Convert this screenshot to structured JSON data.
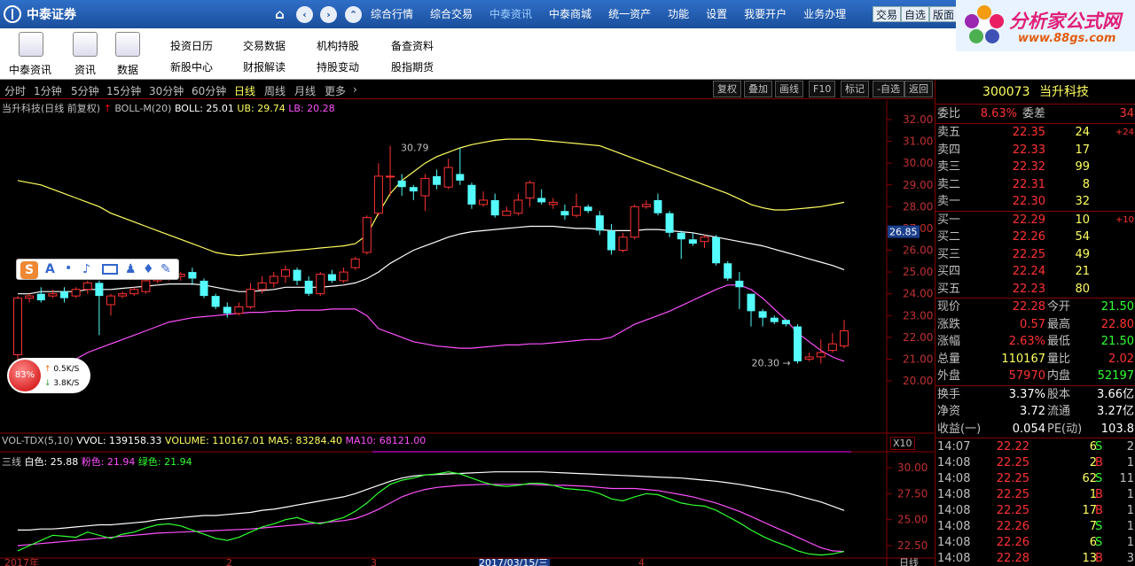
{
  "topbar": {
    "brand": "中泰证券",
    "nav_icons": [
      "home-icon",
      "back-icon",
      "forward-icon",
      "up-icon"
    ],
    "menu": [
      "综合行情",
      "综合交易",
      "中泰资讯",
      "中泰商城",
      "统一资产",
      "功能",
      "设置",
      "我要开户",
      "业务办理"
    ],
    "active_menu": "中泰资讯",
    "right_buttons": [
      "交易",
      "自选",
      "版面"
    ],
    "ad_title": "分析家公式网",
    "ad_url": "www.88gs.com"
  },
  "toolbar": {
    "icons": [
      "中泰资讯",
      "资讯",
      "数据"
    ],
    "links_row1": [
      "投资日历",
      "交易数据",
      "机构持股",
      "备查资料"
    ],
    "links_row2": [
      "新股中心",
      "财报解读",
      "持股变动",
      "股指期货"
    ]
  },
  "periodbar": {
    "periods": [
      "分时",
      "1分钟",
      "5分钟",
      "15分钟",
      "30分钟",
      "60分钟",
      "日线",
      "周线",
      "月线",
      "更多"
    ],
    "active": "日线",
    "buttons": [
      "复权",
      "叠加",
      "画线",
      "F10",
      "标记",
      "-自选",
      "返回"
    ]
  },
  "main_chart": {
    "stock_label": "当升科技(日线 前复权)",
    "indicator": "BOLL-M(20)",
    "boll": "BOLL: 25.01",
    "ub": "UB: 29.74",
    "lb": "LB: 20.28",
    "high_label": "30.79",
    "low_label": "20.30",
    "crosshair_price": "26.85",
    "y_ticks": [
      "32.00",
      "31.00",
      "30.00",
      "29.00",
      "28.00",
      "27.00",
      "26.00",
      "25.00",
      "24.00",
      "23.00",
      "22.00",
      "21.00",
      "20.00"
    ]
  },
  "volume_chart": {
    "label": "VOL-TDX(5,10)",
    "vvol": "VVOL: 139158.33",
    "volume": "VOLUME: 110167.01",
    "ma5": "MA5: 83284.40",
    "ma10": "MA10: 68121.00",
    "scale": "X10"
  },
  "sanxian_chart": {
    "label": "三线",
    "white": "白色: 25.88",
    "pink": "粉色: 21.94",
    "green": "绿色: 21.94",
    "y_ticks": [
      "30.00",
      "27.50",
      "25.00",
      "22.50"
    ]
  },
  "xaxis": {
    "labels": [
      "2017年",
      "2",
      "3",
      "2017/03/15/三",
      "4"
    ],
    "period_label": "日线"
  },
  "quote": {
    "code": "300073",
    "name": "当升科技",
    "weibi_label": "委比",
    "weibi": "8.63%",
    "weicha_label": "委差",
    "weicha": "34",
    "sells": [
      {
        "label": "卖五",
        "price": "22.35",
        "vol": "24",
        "chg": "+24"
      },
      {
        "label": "卖四",
        "price": "22.33",
        "vol": "17",
        "chg": ""
      },
      {
        "label": "卖三",
        "price": "22.32",
        "vol": "99",
        "chg": ""
      },
      {
        "label": "卖二",
        "price": "22.31",
        "vol": "8",
        "chg": ""
      },
      {
        "label": "卖一",
        "price": "22.30",
        "vol": "32",
        "chg": ""
      }
    ],
    "buys": [
      {
        "label": "买一",
        "price": "22.29",
        "vol": "10",
        "chg": "+10"
      },
      {
        "label": "买二",
        "price": "22.26",
        "vol": "54",
        "chg": ""
      },
      {
        "label": "买三",
        "price": "22.25",
        "vol": "49",
        "chg": ""
      },
      {
        "label": "买四",
        "price": "22.24",
        "vol": "21",
        "chg": ""
      },
      {
        "label": "买五",
        "price": "22.23",
        "vol": "80",
        "chg": ""
      }
    ],
    "stats": [
      {
        "l1": "现价",
        "v1": "22.28",
        "l2": "今开",
        "v2": "21.50"
      },
      {
        "l1": "涨跌",
        "v1": "0.57",
        "l2": "最高",
        "v2": "22.80"
      },
      {
        "l1": "涨幅",
        "v1": "2.63%",
        "l2": "最低",
        "v2": "21.50"
      },
      {
        "l1": "总量",
        "v1": "110167",
        "l2": "量比",
        "v2": "2.02"
      },
      {
        "l1": "外盘",
        "v1": "57970",
        "l2": "内盘",
        "v2": "52197"
      }
    ],
    "stats2": [
      {
        "l1": "换手",
        "v1": "3.37%",
        "l2": "股本",
        "v2": "3.66亿"
      },
      {
        "l1": "净资",
        "v1": "3.72",
        "l2": "流通",
        "v2": "3.27亿"
      },
      {
        "l1": "收益(一)",
        "v1": "0.054",
        "l2": "PE(动)",
        "v2": "103.8"
      }
    ],
    "ticks": [
      {
        "time": "14:07",
        "price": "22.22",
        "vol": "6",
        "bs": "S",
        "n": "2"
      },
      {
        "time": "14:08",
        "price": "22.25",
        "vol": "2",
        "bs": "B",
        "n": "1"
      },
      {
        "time": "14:08",
        "price": "22.25",
        "vol": "62",
        "bs": "S",
        "n": "11"
      },
      {
        "time": "14:08",
        "price": "22.25",
        "vol": "1",
        "bs": "B",
        "n": "1"
      },
      {
        "time": "14:08",
        "price": "22.25",
        "vol": "17",
        "bs": "B",
        "n": "1"
      },
      {
        "time": "14:08",
        "price": "22.26",
        "vol": "7",
        "bs": "S",
        "n": "1"
      },
      {
        "time": "14:08",
        "price": "22.26",
        "vol": "6",
        "bs": "S",
        "n": "1"
      },
      {
        "time": "14:08",
        "price": "22.28",
        "vol": "13",
        "bs": "B",
        "n": "3"
      }
    ]
  },
  "speed_widget": {
    "pct": "83%",
    "up": "0.5K/S",
    "down": "3.8K/S"
  },
  "chart_data": {
    "type": "candlestick",
    "title": "当升科技(日线 前复权)",
    "ylim": [
      20,
      32
    ],
    "candles": [
      [
        21.2,
        23.8,
        21.0,
        23.9
      ],
      [
        23.8,
        23.9,
        23.6,
        24.0
      ],
      [
        24.0,
        23.7,
        23.6,
        24.3
      ],
      [
        23.9,
        24.0,
        23.8,
        24.2
      ],
      [
        24.1,
        23.8,
        23.6,
        24.3
      ],
      [
        23.9,
        24.2,
        23.8,
        24.3
      ],
      [
        24.2,
        24.5,
        24.0,
        24.6
      ],
      [
        24.5,
        23.9,
        22.1,
        24.6
      ],
      [
        23.5,
        23.9,
        23.0,
        24.0
      ],
      [
        23.9,
        24.0,
        23.8,
        24.1
      ],
      [
        24.0,
        24.2,
        23.9,
        24.3
      ],
      [
        24.1,
        24.6,
        24.0,
        24.8
      ],
      [
        24.6,
        24.8,
        24.5,
        24.9
      ],
      [
        24.8,
        25.0,
        24.6,
        25.1
      ],
      [
        24.8,
        24.9,
        24.6,
        25.0
      ],
      [
        25.0,
        24.7,
        24.4,
        25.2
      ],
      [
        24.6,
        23.9,
        23.8,
        24.7
      ],
      [
        23.9,
        23.4,
        23.3,
        24.0
      ],
      [
        23.4,
        23.1,
        22.9,
        23.6
      ],
      [
        23.1,
        23.4,
        23.0,
        23.6
      ],
      [
        23.4,
        24.2,
        23.3,
        24.5
      ],
      [
        24.2,
        24.5,
        24.0,
        24.8
      ],
      [
        24.5,
        24.8,
        24.3,
        25.0
      ],
      [
        24.8,
        25.1,
        24.5,
        25.3
      ],
      [
        25.1,
        24.6,
        24.4,
        25.2
      ],
      [
        24.6,
        24.0,
        23.9,
        24.8
      ],
      [
        24.0,
        24.9,
        23.9,
        25.0
      ],
      [
        24.9,
        24.6,
        24.5,
        25.1
      ],
      [
        24.6,
        25.0,
        24.5,
        25.2
      ],
      [
        25.2,
        25.6,
        25.1,
        25.7
      ],
      [
        25.9,
        27.5,
        25.8,
        27.6
      ],
      [
        27.7,
        29.4,
        27.6,
        30.0
      ],
      [
        29.4,
        29.4,
        28.5,
        30.8
      ],
      [
        29.2,
        28.9,
        28.5,
        29.5
      ],
      [
        28.9,
        28.7,
        28.3,
        29.0
      ],
      [
        28.5,
        29.3,
        27.8,
        29.5
      ],
      [
        29.4,
        29.0,
        28.8,
        29.7
      ],
      [
        28.9,
        29.8,
        28.8,
        30.2
      ],
      [
        29.5,
        29.2,
        29.0,
        30.7
      ],
      [
        29.0,
        28.1,
        27.9,
        29.1
      ],
      [
        28.1,
        28.3,
        28.0,
        28.7
      ],
      [
        28.3,
        27.6,
        27.5,
        28.6
      ],
      [
        27.6,
        27.8,
        27.6,
        28.0
      ],
      [
        27.7,
        28.3,
        27.6,
        28.6
      ],
      [
        28.4,
        29.1,
        28.0,
        29.2
      ],
      [
        28.4,
        28.2,
        28.1,
        28.8
      ],
      [
        28.1,
        28.2,
        27.9,
        28.4
      ],
      [
        27.8,
        27.6,
        27.4,
        28.1
      ],
      [
        27.6,
        28.0,
        27.5,
        28.6
      ],
      [
        28.0,
        27.8,
        27.7,
        28.1
      ],
      [
        27.6,
        26.9,
        26.7,
        27.8
      ],
      [
        26.9,
        26.0,
        25.8,
        27.2
      ],
      [
        26.0,
        26.6,
        25.9,
        26.8
      ],
      [
        26.6,
        28.0,
        26.5,
        28.1
      ],
      [
        28.0,
        28.1,
        27.9,
        28.3
      ],
      [
        28.3,
        27.7,
        27.6,
        28.6
      ],
      [
        27.7,
        26.8,
        26.6,
        27.8
      ],
      [
        26.8,
        26.5,
        25.6,
        26.9
      ],
      [
        26.5,
        26.3,
        26.2,
        26.8
      ],
      [
        26.4,
        26.6,
        26.1,
        26.7
      ],
      [
        26.6,
        25.4,
        25.3,
        26.7
      ],
      [
        25.4,
        24.7,
        24.6,
        25.5
      ],
      [
        24.6,
        24.3,
        23.3,
        25.0
      ],
      [
        24.0,
        23.2,
        22.5,
        24.0
      ],
      [
        23.2,
        22.9,
        22.5,
        23.3
      ],
      [
        22.9,
        22.7,
        22.6,
        23.0
      ],
      [
        22.8,
        22.6,
        22.5,
        22.8
      ],
      [
        22.5,
        20.9,
        20.8,
        22.6
      ],
      [
        21.0,
        21.1,
        20.9,
        21.3
      ],
      [
        21.1,
        21.3,
        20.8,
        21.9
      ],
      [
        21.4,
        21.7,
        21.3,
        22.2
      ],
      [
        21.6,
        22.3,
        21.5,
        22.8
      ]
    ],
    "boll_mid": [
      24.0,
      24.0,
      24.1,
      24.1,
      24.1,
      24.1,
      24.2,
      24.2,
      24.2,
      24.25,
      24.3,
      24.35,
      24.4,
      24.45,
      24.45,
      24.45,
      24.4,
      24.3,
      24.2,
      24.1,
      24.1,
      24.15,
      24.2,
      24.3,
      24.3,
      24.3,
      24.3,
      24.35,
      24.4,
      24.5,
      24.7,
      25.0,
      25.4,
      25.7,
      26.0,
      26.2,
      26.4,
      26.6,
      26.75,
      26.85,
      26.9,
      26.95,
      27.0,
      27.05,
      27.1,
      27.1,
      27.1,
      27.05,
      27.0,
      27.0,
      26.95,
      26.9,
      26.9,
      26.9,
      26.95,
      26.95,
      26.9,
      26.85,
      26.8,
      26.7,
      26.6,
      26.5,
      26.4,
      26.3,
      26.2,
      26.05,
      25.9,
      25.75,
      25.6,
      25.45,
      25.3,
      25.1
    ],
    "boll_ub": [
      29.2,
      29.1,
      29.0,
      28.8,
      28.6,
      28.4,
      28.2,
      28.0,
      27.7,
      27.5,
      27.3,
      27.1,
      26.9,
      26.7,
      26.5,
      26.3,
      26.1,
      25.9,
      25.8,
      25.75,
      25.8,
      25.85,
      25.9,
      25.95,
      26.0,
      26.05,
      26.1,
      26.15,
      26.2,
      26.3,
      26.7,
      27.7,
      28.6,
      29.2,
      29.6,
      30.0,
      30.3,
      30.5,
      30.7,
      30.85,
      30.95,
      31.05,
      31.1,
      31.1,
      31.1,
      31.05,
      31.0,
      30.95,
      30.9,
      30.85,
      30.8,
      30.6,
      30.4,
      30.2,
      30.0,
      29.8,
      29.6,
      29.4,
      29.2,
      29.0,
      28.8,
      28.6,
      28.35,
      28.1,
      27.95,
      27.85,
      27.85,
      27.9,
      27.95,
      28.0,
      28.1,
      28.2
    ],
    "boll_lb": [
      20.0,
      20.1,
      20.2,
      20.5,
      20.8,
      21.0,
      21.3,
      21.5,
      21.7,
      21.9,
      22.1,
      22.3,
      22.5,
      22.7,
      22.8,
      22.9,
      22.95,
      23.0,
      23.05,
      23.1,
      23.15,
      23.15,
      23.2,
      23.2,
      23.25,
      23.25,
      23.25,
      23.3,
      23.3,
      23.3,
      23.0,
      22.4,
      22.2,
      22.0,
      21.8,
      21.7,
      21.6,
      21.55,
      21.5,
      21.5,
      21.55,
      21.6,
      21.65,
      21.65,
      21.7,
      21.7,
      21.75,
      21.8,
      21.85,
      21.9,
      21.9,
      22.0,
      22.3,
      22.6,
      22.8,
      23.0,
      23.2,
      23.45,
      23.7,
      23.95,
      24.2,
      24.4,
      24.4,
      24.2,
      23.8,
      23.3,
      22.8,
      22.2,
      21.8,
      21.4,
      21.1,
      20.9
    ],
    "sanxian_white": [
      24.0,
      24.0,
      24.1,
      24.1,
      24.2,
      24.3,
      24.4,
      24.5,
      24.5,
      24.6,
      24.7,
      24.8,
      25.0,
      25.1,
      25.2,
      25.3,
      25.4,
      25.4,
      25.5,
      25.6,
      25.7,
      25.9,
      26.0,
      26.2,
      26.4,
      26.6,
      26.8,
      27.0,
      27.2,
      27.5,
      27.9,
      28.3,
      28.7,
      29.0,
      29.2,
      29.3,
      29.35,
      29.4,
      29.45,
      29.5,
      29.55,
      29.6,
      29.6,
      29.6,
      29.6,
      29.6,
      29.55,
      29.5,
      29.45,
      29.4,
      29.35,
      29.3,
      29.25,
      29.2,
      29.15,
      29.1,
      29.05,
      29.0,
      28.9,
      28.8,
      28.7,
      28.55,
      28.4,
      28.2,
      28.0,
      27.8,
      27.6,
      27.3,
      27.0,
      26.7,
      26.3,
      25.88
    ],
    "sanxian_pink": [
      22.5,
      22.6,
      22.7,
      22.8,
      22.9,
      23.0,
      23.1,
      23.2,
      23.3,
      23.4,
      23.5,
      23.6,
      23.7,
      23.75,
      23.8,
      23.85,
      23.9,
      23.95,
      24.0,
      24.05,
      24.1,
      24.2,
      24.3,
      24.4,
      24.5,
      24.6,
      24.7,
      24.8,
      24.9,
      25.1,
      25.5,
      26.0,
      26.6,
      27.2,
      27.6,
      27.9,
      28.1,
      28.2,
      28.3,
      28.35,
      28.4,
      28.4,
      28.4,
      28.4,
      28.4,
      28.35,
      28.3,
      28.3,
      28.25,
      28.2,
      28.1,
      28.0,
      28.0,
      28.0,
      27.9,
      27.8,
      27.6,
      27.4,
      27.2,
      26.9,
      26.6,
      26.2,
      25.8,
      25.3,
      24.8,
      24.3,
      23.8,
      23.3,
      22.8,
      22.3,
      22.0,
      21.94
    ],
    "sanxian_green": [
      22.0,
      22.5,
      23.0,
      23.5,
      23.4,
      23.3,
      23.8,
      23.5,
      23.2,
      23.6,
      23.8,
      24.2,
      24.5,
      24.6,
      24.4,
      24.0,
      23.6,
      23.2,
      23.0,
      23.3,
      23.8,
      24.3,
      24.6,
      25.0,
      25.2,
      24.8,
      24.6,
      24.9,
      25.2,
      25.8,
      26.6,
      27.6,
      28.4,
      28.8,
      29.0,
      29.3,
      29.4,
      29.6,
      29.4,
      29.0,
      28.6,
      28.3,
      28.2,
      28.3,
      28.5,
      28.5,
      28.3,
      28.0,
      27.9,
      27.8,
      27.5,
      27.0,
      26.8,
      27.2,
      27.5,
      27.4,
      27.0,
      26.6,
      26.4,
      26.3,
      25.9,
      25.3,
      24.7,
      24.0,
      23.4,
      22.9,
      22.5,
      22.0,
      21.7,
      21.6,
      21.7,
      21.94
    ]
  }
}
